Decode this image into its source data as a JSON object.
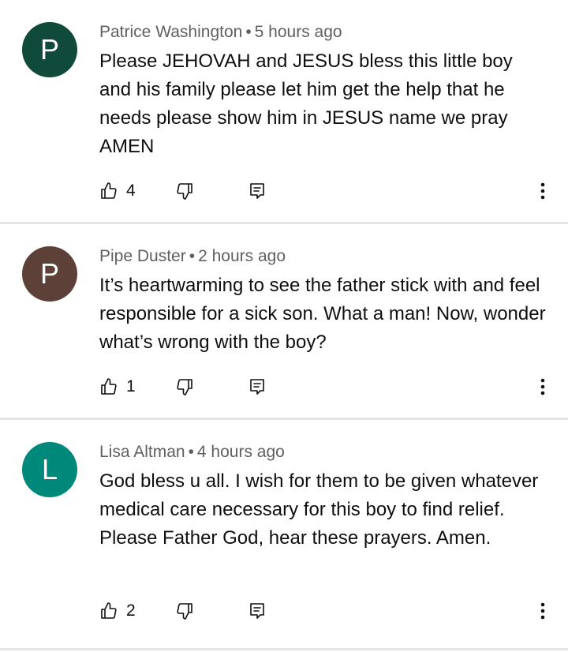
{
  "colors": {
    "avatar_patrice": "#104a3b",
    "avatar_pipe": "#5d4037",
    "avatar_lisa": "#00897b",
    "meta_text": "#606060",
    "divider": "#e5e5e5"
  },
  "comments": [
    {
      "avatar_letter": "P",
      "author": "Patrice Washington",
      "separator": "•",
      "time": "5 hours ago",
      "text": "Please JEHOVAH and JESUS bless this little boy and his family please let him get the help that he needs please show him in JESUS name we pray AMEN",
      "likes": "4"
    },
    {
      "avatar_letter": "P",
      "author": "Pipe Duster",
      "separator": "•",
      "time": "2 hours ago",
      "text": "It’s heartwarming to see the father stick with and feel responsible for a sick son. What a man!  Now, wonder what’s wrong with the boy?",
      "likes": "1"
    },
    {
      "avatar_letter": "L",
      "author": "Lisa Altman",
      "separator": "•",
      "time": "4 hours ago",
      "text": "God bless u all. I wish for them to be given whatever medical care necessary for this boy to find relief. Please Father God, hear these prayers. Amen.",
      "likes": "2"
    }
  ],
  "icons": {
    "like": "thumbs-up-icon",
    "dislike": "thumbs-down-icon",
    "reply": "reply-icon",
    "more": "more-vert-icon"
  }
}
